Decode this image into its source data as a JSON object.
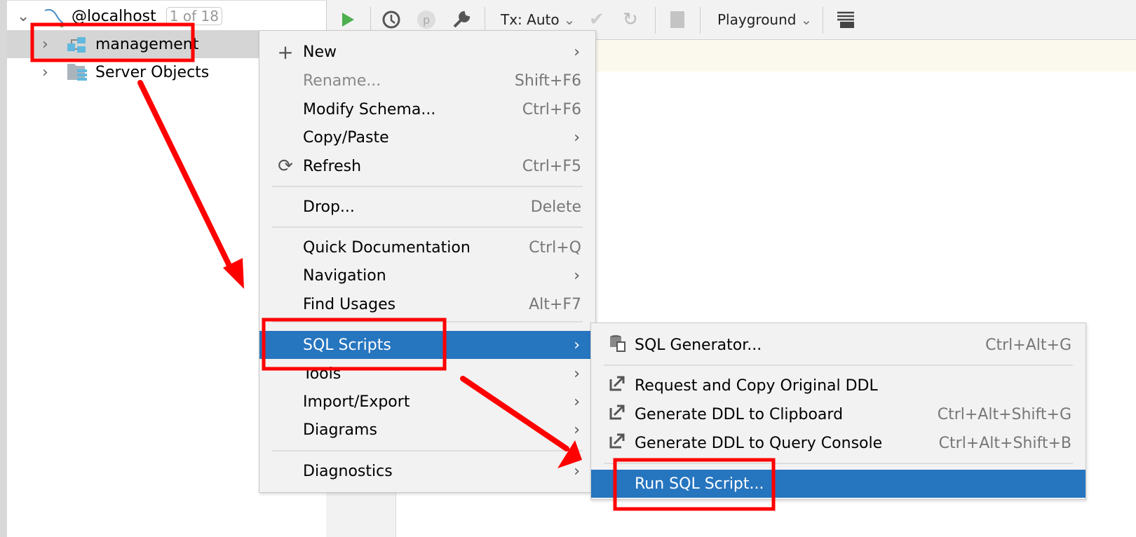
{
  "tree": {
    "root": {
      "label": "@localhost",
      "badge": "1 of 18"
    },
    "items": [
      {
        "label": "management",
        "icon": "schema-icon"
      },
      {
        "label": "Server Objects",
        "icon": "server-objects-icon"
      }
    ]
  },
  "toolbar": {
    "tx": "Tx: Auto",
    "playground": "Playground"
  },
  "context_menu": {
    "items": [
      {
        "label": "New",
        "icon": "plus-icon",
        "submenu": true
      },
      {
        "label": "Rename...",
        "shortcut": "Shift+F6",
        "disabled": true
      },
      {
        "label": "Modify Schema...",
        "shortcut": "Ctrl+F6"
      },
      {
        "label": "Copy/Paste",
        "submenu": true
      },
      {
        "label": "Refresh",
        "icon": "refresh-icon",
        "shortcut": "Ctrl+F5"
      },
      {
        "label": "Drop...",
        "shortcut": "Delete"
      },
      {
        "label": "Quick Documentation",
        "shortcut": "Ctrl+Q"
      },
      {
        "label": "Navigation",
        "submenu": true
      },
      {
        "label": "Find Usages",
        "shortcut": "Alt+F7"
      },
      {
        "label": "SQL Scripts",
        "submenu": true,
        "selected": true
      },
      {
        "label": "Tools",
        "submenu": true
      },
      {
        "label": "Import/Export",
        "submenu": true
      },
      {
        "label": "Diagrams",
        "submenu": true
      },
      {
        "label": "Diagnostics",
        "submenu": true
      }
    ]
  },
  "submenu": {
    "items": [
      {
        "label": "SQL Generator...",
        "shortcut": "Ctrl+Alt+G",
        "icon": "sql-generator-icon"
      },
      {
        "label": "Request and Copy Original DDL",
        "icon": "export-arrow-icon"
      },
      {
        "label": "Generate DDL to Clipboard",
        "shortcut": "Ctrl+Alt+Shift+G",
        "icon": "export-arrow-icon"
      },
      {
        "label": "Generate DDL to Query Console",
        "shortcut": "Ctrl+Alt+Shift+B",
        "icon": "export-arrow-icon"
      },
      {
        "label": "Run SQL Script...",
        "selected": true
      }
    ]
  },
  "colors": {
    "selection": "#2675bf",
    "annotation": "#ff0000",
    "run": "#4caf50"
  }
}
